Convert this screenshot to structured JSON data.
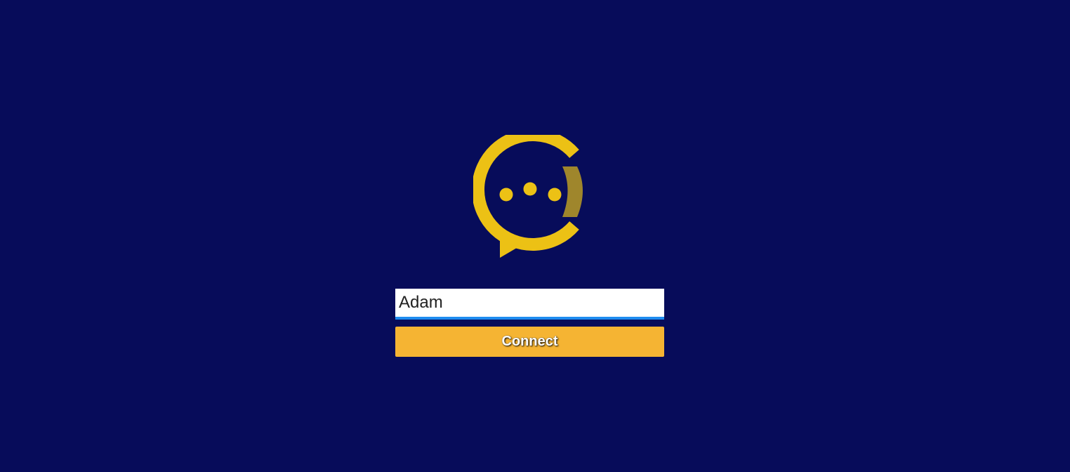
{
  "colors": {
    "background": "#070c5a",
    "brand_yellow": "#ecc115",
    "brand_olive": "#9f862c",
    "input_underline": "#1f8cf0",
    "button_bg": "#f5b433"
  },
  "logo": {
    "icon": "chat-bubble-logo-icon"
  },
  "login": {
    "name_value": "Adam",
    "connect_label": "Connect"
  }
}
